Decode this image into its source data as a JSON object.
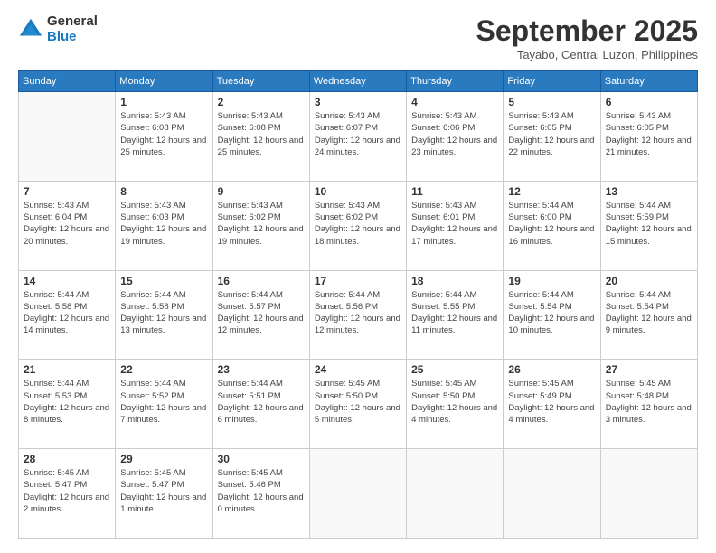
{
  "logo": {
    "general": "General",
    "blue": "Blue"
  },
  "header": {
    "month": "September 2025",
    "location": "Tayabo, Central Luzon, Philippines"
  },
  "weekdays": [
    "Sunday",
    "Monday",
    "Tuesday",
    "Wednesday",
    "Thursday",
    "Friday",
    "Saturday"
  ],
  "weeks": [
    [
      {
        "day": "",
        "info": ""
      },
      {
        "day": "1",
        "info": "Sunrise: 5:43 AM\nSunset: 6:08 PM\nDaylight: 12 hours\nand 25 minutes."
      },
      {
        "day": "2",
        "info": "Sunrise: 5:43 AM\nSunset: 6:08 PM\nDaylight: 12 hours\nand 25 minutes."
      },
      {
        "day": "3",
        "info": "Sunrise: 5:43 AM\nSunset: 6:07 PM\nDaylight: 12 hours\nand 24 minutes."
      },
      {
        "day": "4",
        "info": "Sunrise: 5:43 AM\nSunset: 6:06 PM\nDaylight: 12 hours\nand 23 minutes."
      },
      {
        "day": "5",
        "info": "Sunrise: 5:43 AM\nSunset: 6:05 PM\nDaylight: 12 hours\nand 22 minutes."
      },
      {
        "day": "6",
        "info": "Sunrise: 5:43 AM\nSunset: 6:05 PM\nDaylight: 12 hours\nand 21 minutes."
      }
    ],
    [
      {
        "day": "7",
        "info": "Sunrise: 5:43 AM\nSunset: 6:04 PM\nDaylight: 12 hours\nand 20 minutes."
      },
      {
        "day": "8",
        "info": "Sunrise: 5:43 AM\nSunset: 6:03 PM\nDaylight: 12 hours\nand 19 minutes."
      },
      {
        "day": "9",
        "info": "Sunrise: 5:43 AM\nSunset: 6:02 PM\nDaylight: 12 hours\nand 19 minutes."
      },
      {
        "day": "10",
        "info": "Sunrise: 5:43 AM\nSunset: 6:02 PM\nDaylight: 12 hours\nand 18 minutes."
      },
      {
        "day": "11",
        "info": "Sunrise: 5:43 AM\nSunset: 6:01 PM\nDaylight: 12 hours\nand 17 minutes."
      },
      {
        "day": "12",
        "info": "Sunrise: 5:44 AM\nSunset: 6:00 PM\nDaylight: 12 hours\nand 16 minutes."
      },
      {
        "day": "13",
        "info": "Sunrise: 5:44 AM\nSunset: 5:59 PM\nDaylight: 12 hours\nand 15 minutes."
      }
    ],
    [
      {
        "day": "14",
        "info": "Sunrise: 5:44 AM\nSunset: 5:58 PM\nDaylight: 12 hours\nand 14 minutes."
      },
      {
        "day": "15",
        "info": "Sunrise: 5:44 AM\nSunset: 5:58 PM\nDaylight: 12 hours\nand 13 minutes."
      },
      {
        "day": "16",
        "info": "Sunrise: 5:44 AM\nSunset: 5:57 PM\nDaylight: 12 hours\nand 12 minutes."
      },
      {
        "day": "17",
        "info": "Sunrise: 5:44 AM\nSunset: 5:56 PM\nDaylight: 12 hours\nand 12 minutes."
      },
      {
        "day": "18",
        "info": "Sunrise: 5:44 AM\nSunset: 5:55 PM\nDaylight: 12 hours\nand 11 minutes."
      },
      {
        "day": "19",
        "info": "Sunrise: 5:44 AM\nSunset: 5:54 PM\nDaylight: 12 hours\nand 10 minutes."
      },
      {
        "day": "20",
        "info": "Sunrise: 5:44 AM\nSunset: 5:54 PM\nDaylight: 12 hours\nand 9 minutes."
      }
    ],
    [
      {
        "day": "21",
        "info": "Sunrise: 5:44 AM\nSunset: 5:53 PM\nDaylight: 12 hours\nand 8 minutes."
      },
      {
        "day": "22",
        "info": "Sunrise: 5:44 AM\nSunset: 5:52 PM\nDaylight: 12 hours\nand 7 minutes."
      },
      {
        "day": "23",
        "info": "Sunrise: 5:44 AM\nSunset: 5:51 PM\nDaylight: 12 hours\nand 6 minutes."
      },
      {
        "day": "24",
        "info": "Sunrise: 5:45 AM\nSunset: 5:50 PM\nDaylight: 12 hours\nand 5 minutes."
      },
      {
        "day": "25",
        "info": "Sunrise: 5:45 AM\nSunset: 5:50 PM\nDaylight: 12 hours\nand 4 minutes."
      },
      {
        "day": "26",
        "info": "Sunrise: 5:45 AM\nSunset: 5:49 PM\nDaylight: 12 hours\nand 4 minutes."
      },
      {
        "day": "27",
        "info": "Sunrise: 5:45 AM\nSunset: 5:48 PM\nDaylight: 12 hours\nand 3 minutes."
      }
    ],
    [
      {
        "day": "28",
        "info": "Sunrise: 5:45 AM\nSunset: 5:47 PM\nDaylight: 12 hours\nand 2 minutes."
      },
      {
        "day": "29",
        "info": "Sunrise: 5:45 AM\nSunset: 5:47 PM\nDaylight: 12 hours\nand 1 minute."
      },
      {
        "day": "30",
        "info": "Sunrise: 5:45 AM\nSunset: 5:46 PM\nDaylight: 12 hours\nand 0 minutes."
      },
      {
        "day": "",
        "info": ""
      },
      {
        "day": "",
        "info": ""
      },
      {
        "day": "",
        "info": ""
      },
      {
        "day": "",
        "info": ""
      }
    ]
  ]
}
